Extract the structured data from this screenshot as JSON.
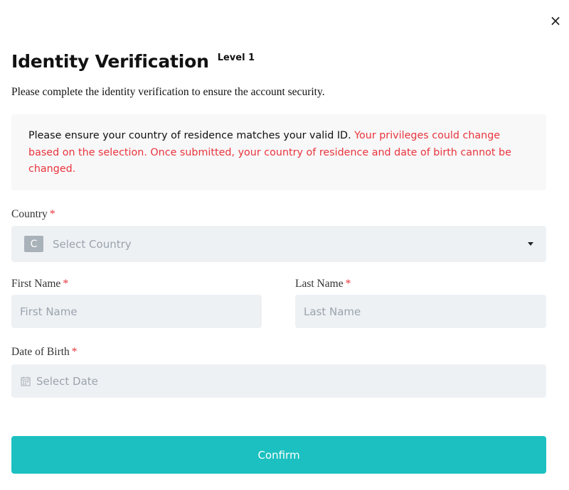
{
  "dialog": {
    "close_symbol": "×",
    "title": "Identity Verification",
    "level": "Level 1",
    "subtitle": "Please complete the identity verification to ensure the account security."
  },
  "notice": {
    "text": "Please ensure your country of residence matches your valid ID.",
    "warning": "Your privileges could change based on the selection. Once submitted, your country of residence and date of birth cannot be changed."
  },
  "form": {
    "required_mark": "*",
    "country": {
      "label": "Country",
      "badge": "C",
      "placeholder": "Select Country",
      "icon": "caret-down-icon"
    },
    "first_name": {
      "label": "First Name",
      "placeholder": "First Name"
    },
    "last_name": {
      "label": "Last Name",
      "placeholder": "Last Name"
    },
    "dob": {
      "label": "Date of Birth",
      "placeholder": "Select Date",
      "icon": "calendar-icon"
    },
    "confirm_label": "Confirm"
  },
  "colors": {
    "accent": "#1cc0c0",
    "warning": "#e8343b",
    "field_bg": "#eef1f4",
    "notice_bg": "#f8f8f9"
  }
}
